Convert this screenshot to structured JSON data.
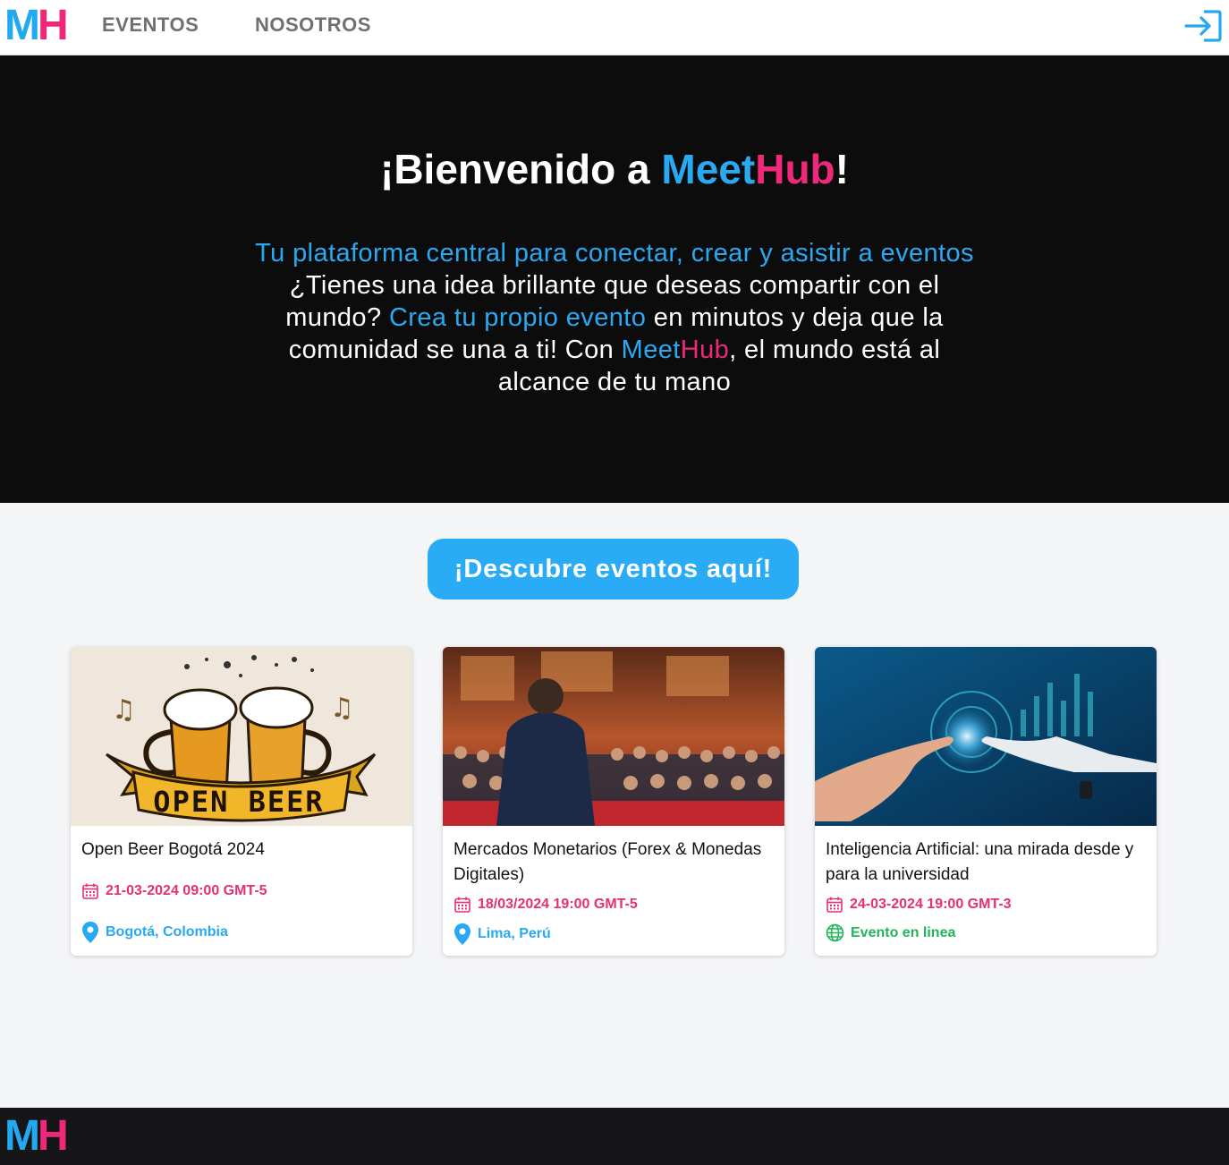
{
  "nav": {
    "logo_m": "M",
    "logo_h": "H",
    "links": [
      "EVENTOS",
      "NOSOTROS"
    ],
    "login_icon": "login-icon"
  },
  "hero": {
    "title_prefix": "¡Bienvenido a ",
    "title_meet": "Meet",
    "title_hub": "Hub",
    "title_suffix": "!",
    "text_1": "Tu plataforma central para conectar, crear y asistir a eventos",
    "text_2": " ¿Tienes una idea brillante que deseas compartir con el mundo? ",
    "text_3": "Crea tu propio evento",
    "text_4": " en minutos y deja que la comunidad se una a ti! Con ",
    "text_meet": "Meet",
    "text_hub": "Hub",
    "text_5": ", el mundo está al alcance de tu mano"
  },
  "discover_button": "¡Descubre eventos aquí!",
  "events": [
    {
      "title": "Open Beer Bogotá 2024",
      "date": "21-03-2024 09:00 GMT-5",
      "location": "Bogotá, Colombia",
      "location_type": "place",
      "image_text": "OPEN BEER"
    },
    {
      "title": "Mercados Monetarios (Forex & Monedas Digitales)",
      "date": "18/03/2024 19:00 GMT-5",
      "location": "Lima, Perú",
      "location_type": "place"
    },
    {
      "title": "Inteligencia Artificial: una mirada desde y para la universidad",
      "date": "24-03-2024 19:00 GMT-3",
      "location": "Evento en linea",
      "location_type": "online"
    }
  ],
  "footer": {
    "logo_m": "M",
    "logo_h": "H"
  },
  "colors": {
    "brand_blue": "#2aa9f3",
    "brand_pink": "#f0287a",
    "date_pink": "#e62f74",
    "online_green": "#22b45a"
  }
}
